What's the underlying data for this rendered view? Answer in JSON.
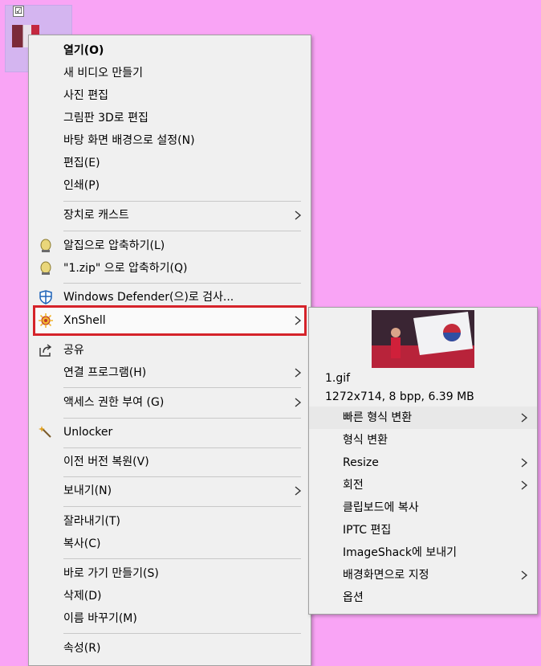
{
  "desktop": {
    "background": "#f9a4f5",
    "file_checkbox": "☑"
  },
  "context_menu": {
    "items": [
      {
        "label": "열기(O)"
      },
      {
        "label": "새 비디오 만들기"
      },
      {
        "label": "사진 편집"
      },
      {
        "label": "그림판 3D로 편집"
      },
      {
        "label": "바탕 화면 배경으로 설정(N)"
      },
      {
        "label": "편집(E)"
      },
      {
        "label": "인쇄(P)"
      },
      {
        "label": "장치로 캐스트"
      },
      {
        "label": "알집으로 압축하기(L)"
      },
      {
        "label": "\"1.zip\" 으로 압축하기(Q)"
      },
      {
        "label": "Windows Defender(으)로 검사..."
      },
      {
        "label": "XnShell"
      },
      {
        "label": "공유"
      },
      {
        "label": "연결 프로그램(H)"
      },
      {
        "label": "액세스 권한 부여 (G)"
      },
      {
        "label": "Unlocker"
      },
      {
        "label": "이전 버전 복원(V)"
      },
      {
        "label": "보내기(N)"
      },
      {
        "label": "잘라내기(T)"
      },
      {
        "label": "복사(C)"
      },
      {
        "label": "바로 가기 만들기(S)"
      },
      {
        "label": "삭제(D)"
      },
      {
        "label": "이름 바꾸기(M)"
      },
      {
        "label": "속성(R)"
      }
    ]
  },
  "xnshell_submenu": {
    "filename": "1.gif",
    "info": "1272x714, 8 bpp, 6.39 MB",
    "items": [
      {
        "label": "빠른 형식 변환"
      },
      {
        "label": "형식 변환"
      },
      {
        "label": "Resize"
      },
      {
        "label": "회전"
      },
      {
        "label": "클립보드에 복사"
      },
      {
        "label": "IPTC 편집"
      },
      {
        "label": "ImageShack에 보내기"
      },
      {
        "label": "배경화면으로 지정"
      },
      {
        "label": "옵션"
      }
    ]
  },
  "colors": {
    "highlight_border": "#d5232a",
    "menu_bg": "#f0f0f0"
  }
}
